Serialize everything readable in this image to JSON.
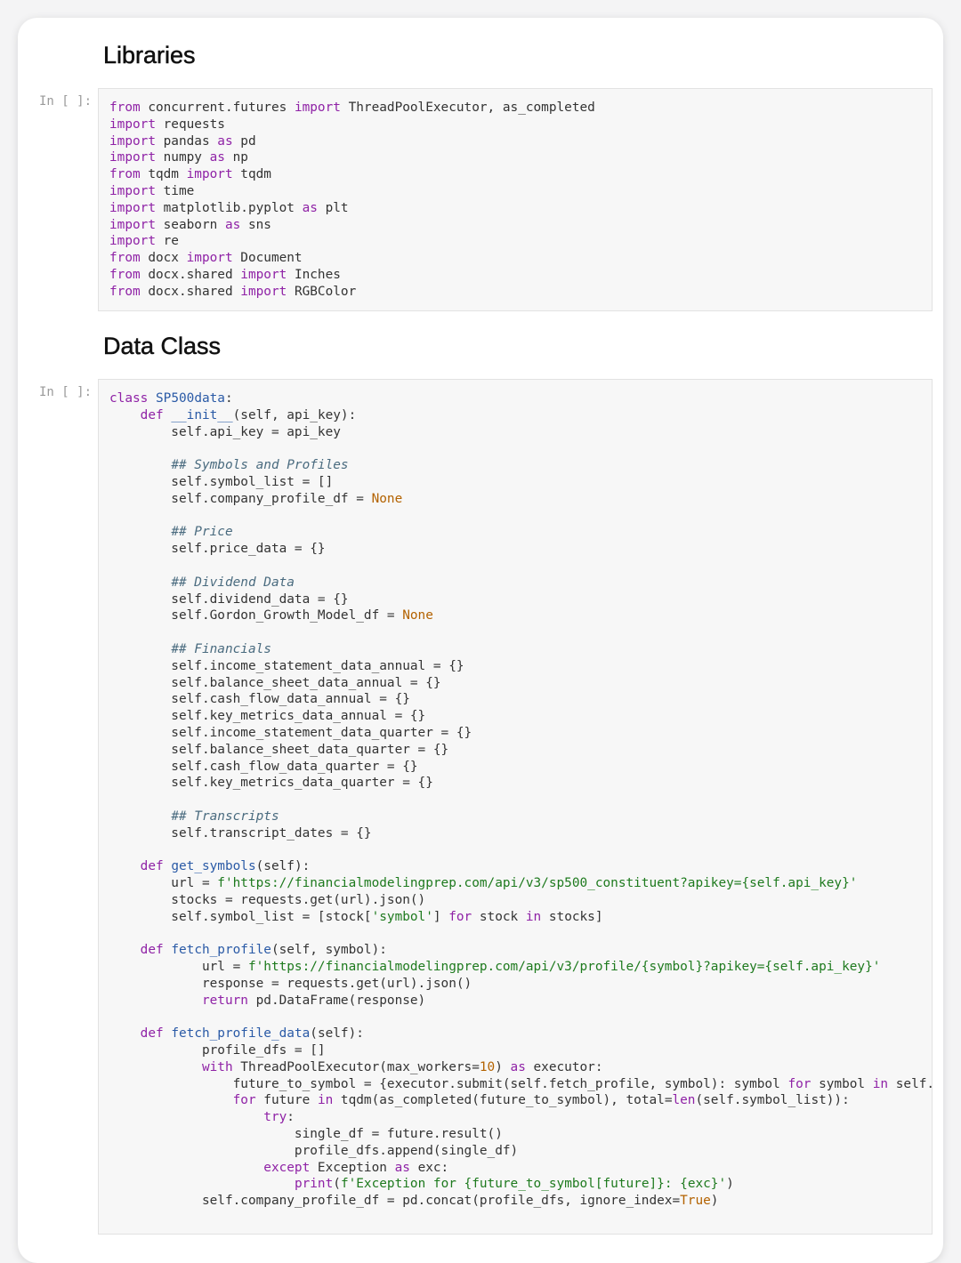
{
  "sections": {
    "libraries_title": "Libraries",
    "dataclass_title": "Data Class"
  },
  "cells": [
    {
      "prompt": "In [ ]:",
      "code_lines": [
        "from concurrent.futures import ThreadPoolExecutor, as_completed",
        "import requests",
        "import pandas as pd",
        "import numpy as np",
        "from tqdm import tqdm",
        "import time",
        "import matplotlib.pyplot as plt",
        "import seaborn as sns",
        "import re",
        "from docx import Document",
        "from docx.shared import Inches",
        "from docx.shared import RGBColor"
      ]
    },
    {
      "prompt": "In [ ]:",
      "code_lines": [
        "class SP500data:",
        "    def __init__(self, api_key):",
        "        self.api_key = api_key",
        "",
        "        ## Symbols and Profiles",
        "        self.symbol_list = []",
        "        self.company_profile_df = None",
        "",
        "        ## Price",
        "        self.price_data = {}",
        "",
        "        ## Dividend Data",
        "        self.dividend_data = {}",
        "        self.Gordon_Growth_Model_df = None",
        "",
        "        ## Financials",
        "        self.income_statement_data_annual = {}",
        "        self.balance_sheet_data_annual = {}",
        "        self.cash_flow_data_annual = {}",
        "        self.key_metrics_data_annual = {}",
        "        self.income_statement_data_quarter = {}",
        "        self.balance_sheet_data_quarter = {}",
        "        self.cash_flow_data_quarter = {}",
        "        self.key_metrics_data_quarter = {}",
        "",
        "        ## Transcripts",
        "        self.transcript_dates = {}",
        "",
        "    def get_symbols(self):",
        "        url = f'https://financialmodelingprep.com/api/v3/sp500_constituent?apikey={self.api_key}'",
        "        stocks = requests.get(url).json()",
        "        self.symbol_list = [stock['symbol'] for stock in stocks]",
        "",
        "    def fetch_profile(self, symbol):",
        "            url = f'https://financialmodelingprep.com/api/v3/profile/{symbol}?apikey={self.api_key}'",
        "            response = requests.get(url).json()",
        "            return pd.DataFrame(response)",
        "",
        "    def fetch_profile_data(self):",
        "            profile_dfs = []",
        "            with ThreadPoolExecutor(max_workers=10) as executor:",
        "                future_to_symbol = {executor.submit(self.fetch_profile, symbol): symbol for symbol in self.",
        "                for future in tqdm(as_completed(future_to_symbol), total=len(self.symbol_list)):",
        "                    try:",
        "                        single_df = future.result()",
        "                        profile_dfs.append(single_df)",
        "                    except Exception as exc:",
        "                        print(f'Exception for {future_to_symbol[future]}: {exc}')",
        "            self.company_profile_df = pd.concat(profile_dfs, ignore_index=True)"
      ]
    }
  ]
}
